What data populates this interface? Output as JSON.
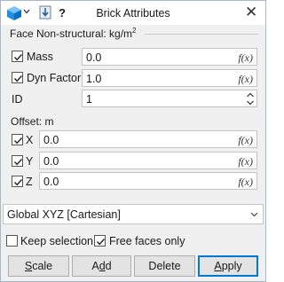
{
  "window": {
    "title": "Brick Attributes"
  },
  "toolbar": {
    "help_label": "?",
    "close_glyph": "✕",
    "view_icon": "cube-icon",
    "download_icon": "download-icon"
  },
  "face": {
    "group_label": "Face Non-structural: kg/m",
    "group_label_sup": "2",
    "mass": {
      "label": "Mass",
      "checked": true,
      "value": "0.0",
      "fx": "f(x)"
    },
    "dyn_factor": {
      "label": "Dyn Factor",
      "checked": true,
      "value": "1.0",
      "fx": "f(x)"
    },
    "id": {
      "label": "ID",
      "value": "1"
    }
  },
  "offset": {
    "label": "Offset: m",
    "x": {
      "label": "X",
      "checked": true,
      "value": "0.0",
      "fx": "f(x)"
    },
    "y": {
      "label": "Y",
      "checked": true,
      "value": "0.0",
      "fx": "f(x)"
    },
    "z": {
      "label": "Z",
      "checked": true,
      "value": "0.0",
      "fx": "f(x)"
    }
  },
  "coord_system": {
    "value": "Global XYZ [Cartesian]"
  },
  "options": {
    "keep_selection": {
      "label": "Keep selection",
      "checked": false
    },
    "free_faces_only": {
      "label": "Free faces only",
      "checked": true
    }
  },
  "buttons": {
    "scale": {
      "mnemonic": "S",
      "rest": "cale"
    },
    "add": {
      "pre": "A",
      "mnemonic": "d",
      "rest": "d"
    },
    "delete": {
      "label": "Delete"
    },
    "apply": {
      "mnemonic": "A",
      "rest": "pply"
    }
  },
  "colors": {
    "accent": "#0078d7",
    "cube": "#1f8fe0"
  }
}
